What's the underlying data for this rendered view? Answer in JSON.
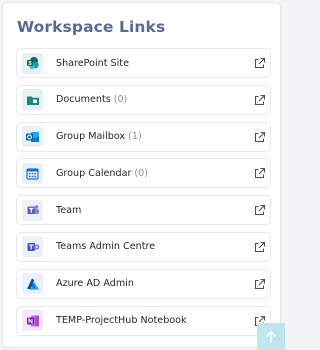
{
  "widget": {
    "title": "Workspace Links"
  },
  "links": [
    {
      "label": "SharePoint Site",
      "count": "",
      "icon": "sharepoint-icon",
      "color": "#0f7c7a",
      "bg": "#e7f1f2"
    },
    {
      "label": "Documents",
      "count": "(0)",
      "icon": "folder-icon",
      "color": "#138a7a",
      "bg": "#e7f1f2"
    },
    {
      "label": "Group Mailbox",
      "count": "(1)",
      "icon": "outlook-icon",
      "color": "#0f6cbd",
      "bg": "#e8f0fa"
    },
    {
      "label": "Group Calendar",
      "count": "(0)",
      "icon": "calendar-icon",
      "color": "#1c74d0",
      "bg": "#e8f0fa"
    },
    {
      "label": "Team",
      "count": "",
      "icon": "teams-icon",
      "color": "#5b5fc7",
      "bg": "#eeeff9"
    },
    {
      "label": "Teams Admin Centre",
      "count": "",
      "icon": "teams-admin-icon",
      "color": "#4b53bc",
      "bg": "#eeeff9"
    },
    {
      "label": "Azure AD Admin",
      "count": "",
      "icon": "azure-icon",
      "color": "#0078d4",
      "bg": "#e8f0fa"
    },
    {
      "label": "TEMP-ProjectHub Notebook",
      "count": "",
      "icon": "onenote-icon",
      "color": "#7719aa",
      "bg": "#f3e8f8"
    }
  ],
  "scroll_top": {
    "icon": "arrow-up-icon",
    "color": "#bfe6ea"
  }
}
